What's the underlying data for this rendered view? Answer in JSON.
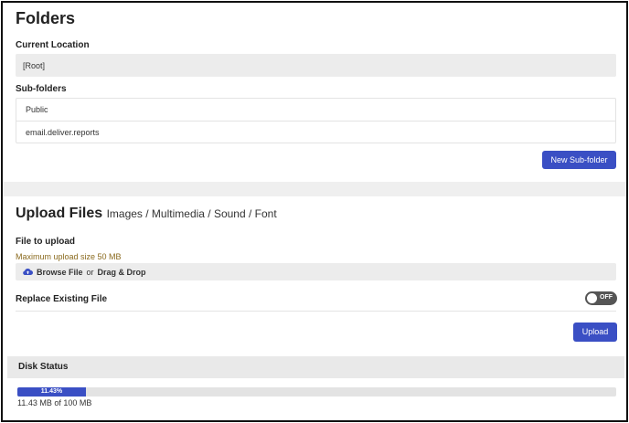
{
  "folders": {
    "title": "Folders",
    "current_location_label": "Current Location",
    "current_location_value": "[Root]",
    "subfolders_label": "Sub-folders",
    "subfolders": [
      "Public",
      "email.deliver.reports"
    ],
    "new_subfolder_button": "New Sub-folder"
  },
  "upload": {
    "title": "Upload Files",
    "types": "Images / Multimedia / Sound / Font",
    "file_label": "File to upload",
    "max_size": "Maximum upload size 50 MB",
    "browse": "Browse File",
    "or": "or",
    "drag_drop": "Drag & Drop",
    "replace_label": "Replace Existing File",
    "replace_state": "OFF",
    "upload_button": "Upload"
  },
  "disk": {
    "title": "Disk Status",
    "used_fraction": 0.1143,
    "percent_label": "11.43%",
    "usage_text": "11.43 MB of 100 MB"
  },
  "colors": {
    "accent": "#3a4fc4",
    "warning_text": "#8a6a1e"
  },
  "icons": {
    "browse": "cloud-upload-icon"
  }
}
